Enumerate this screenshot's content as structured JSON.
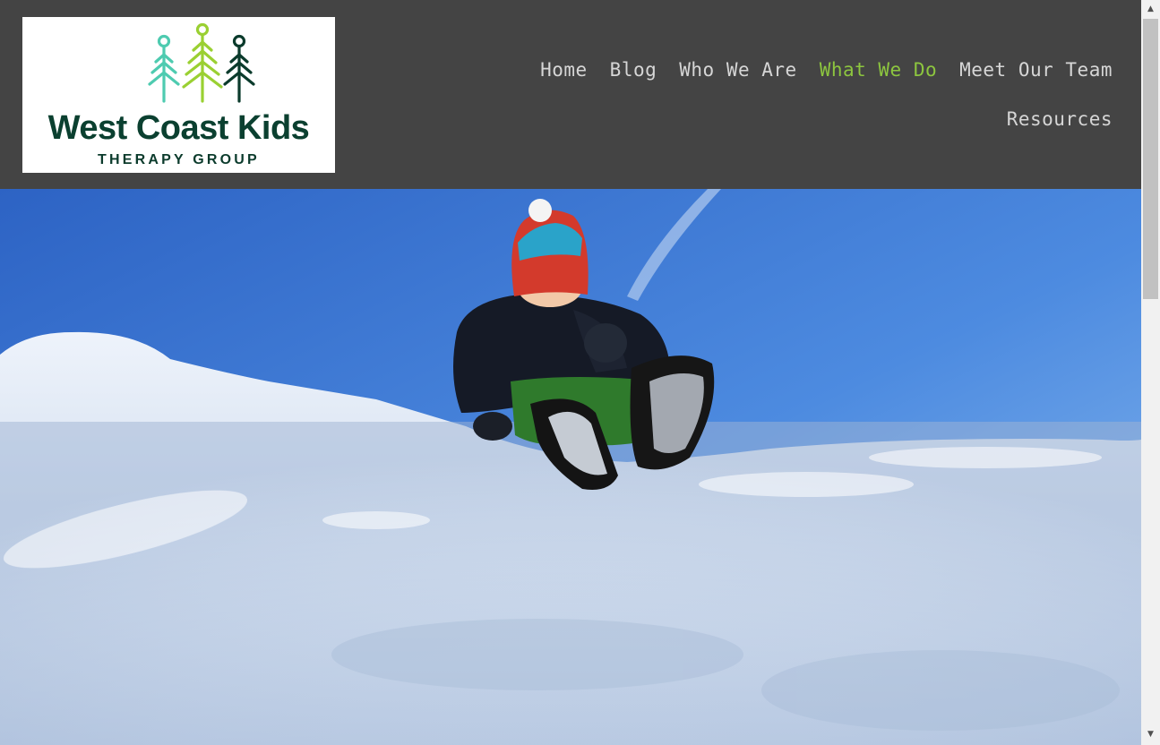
{
  "logo": {
    "name": "West Coast Kids",
    "subtitle": "THERAPY GROUP",
    "icon": "three-trees-logo-icon"
  },
  "nav": {
    "row1": [
      {
        "label": "Home",
        "active": false
      },
      {
        "label": "Blog",
        "active": false
      },
      {
        "label": "Who We Are",
        "active": false
      },
      {
        "label": "What We Do",
        "active": true
      },
      {
        "label": "Meet Our Team",
        "active": false
      }
    ],
    "row2": [
      {
        "label": "Resources",
        "active": false
      }
    ]
  },
  "hero": {
    "image": "child-sitting-on-snow-bank-photo"
  },
  "colors": {
    "header_bg": "#444444",
    "nav_text": "#d6d6d6",
    "nav_active": "#8dc63f",
    "brand_dark_green": "#0b4030",
    "tree_teal": "#4ecbb0",
    "tree_lime": "#9ad032",
    "tree_dark": "#0b3b2c"
  },
  "scrollbar": {
    "up_icon": "scroll-up-arrow-icon",
    "down_icon": "scroll-down-arrow-icon"
  }
}
